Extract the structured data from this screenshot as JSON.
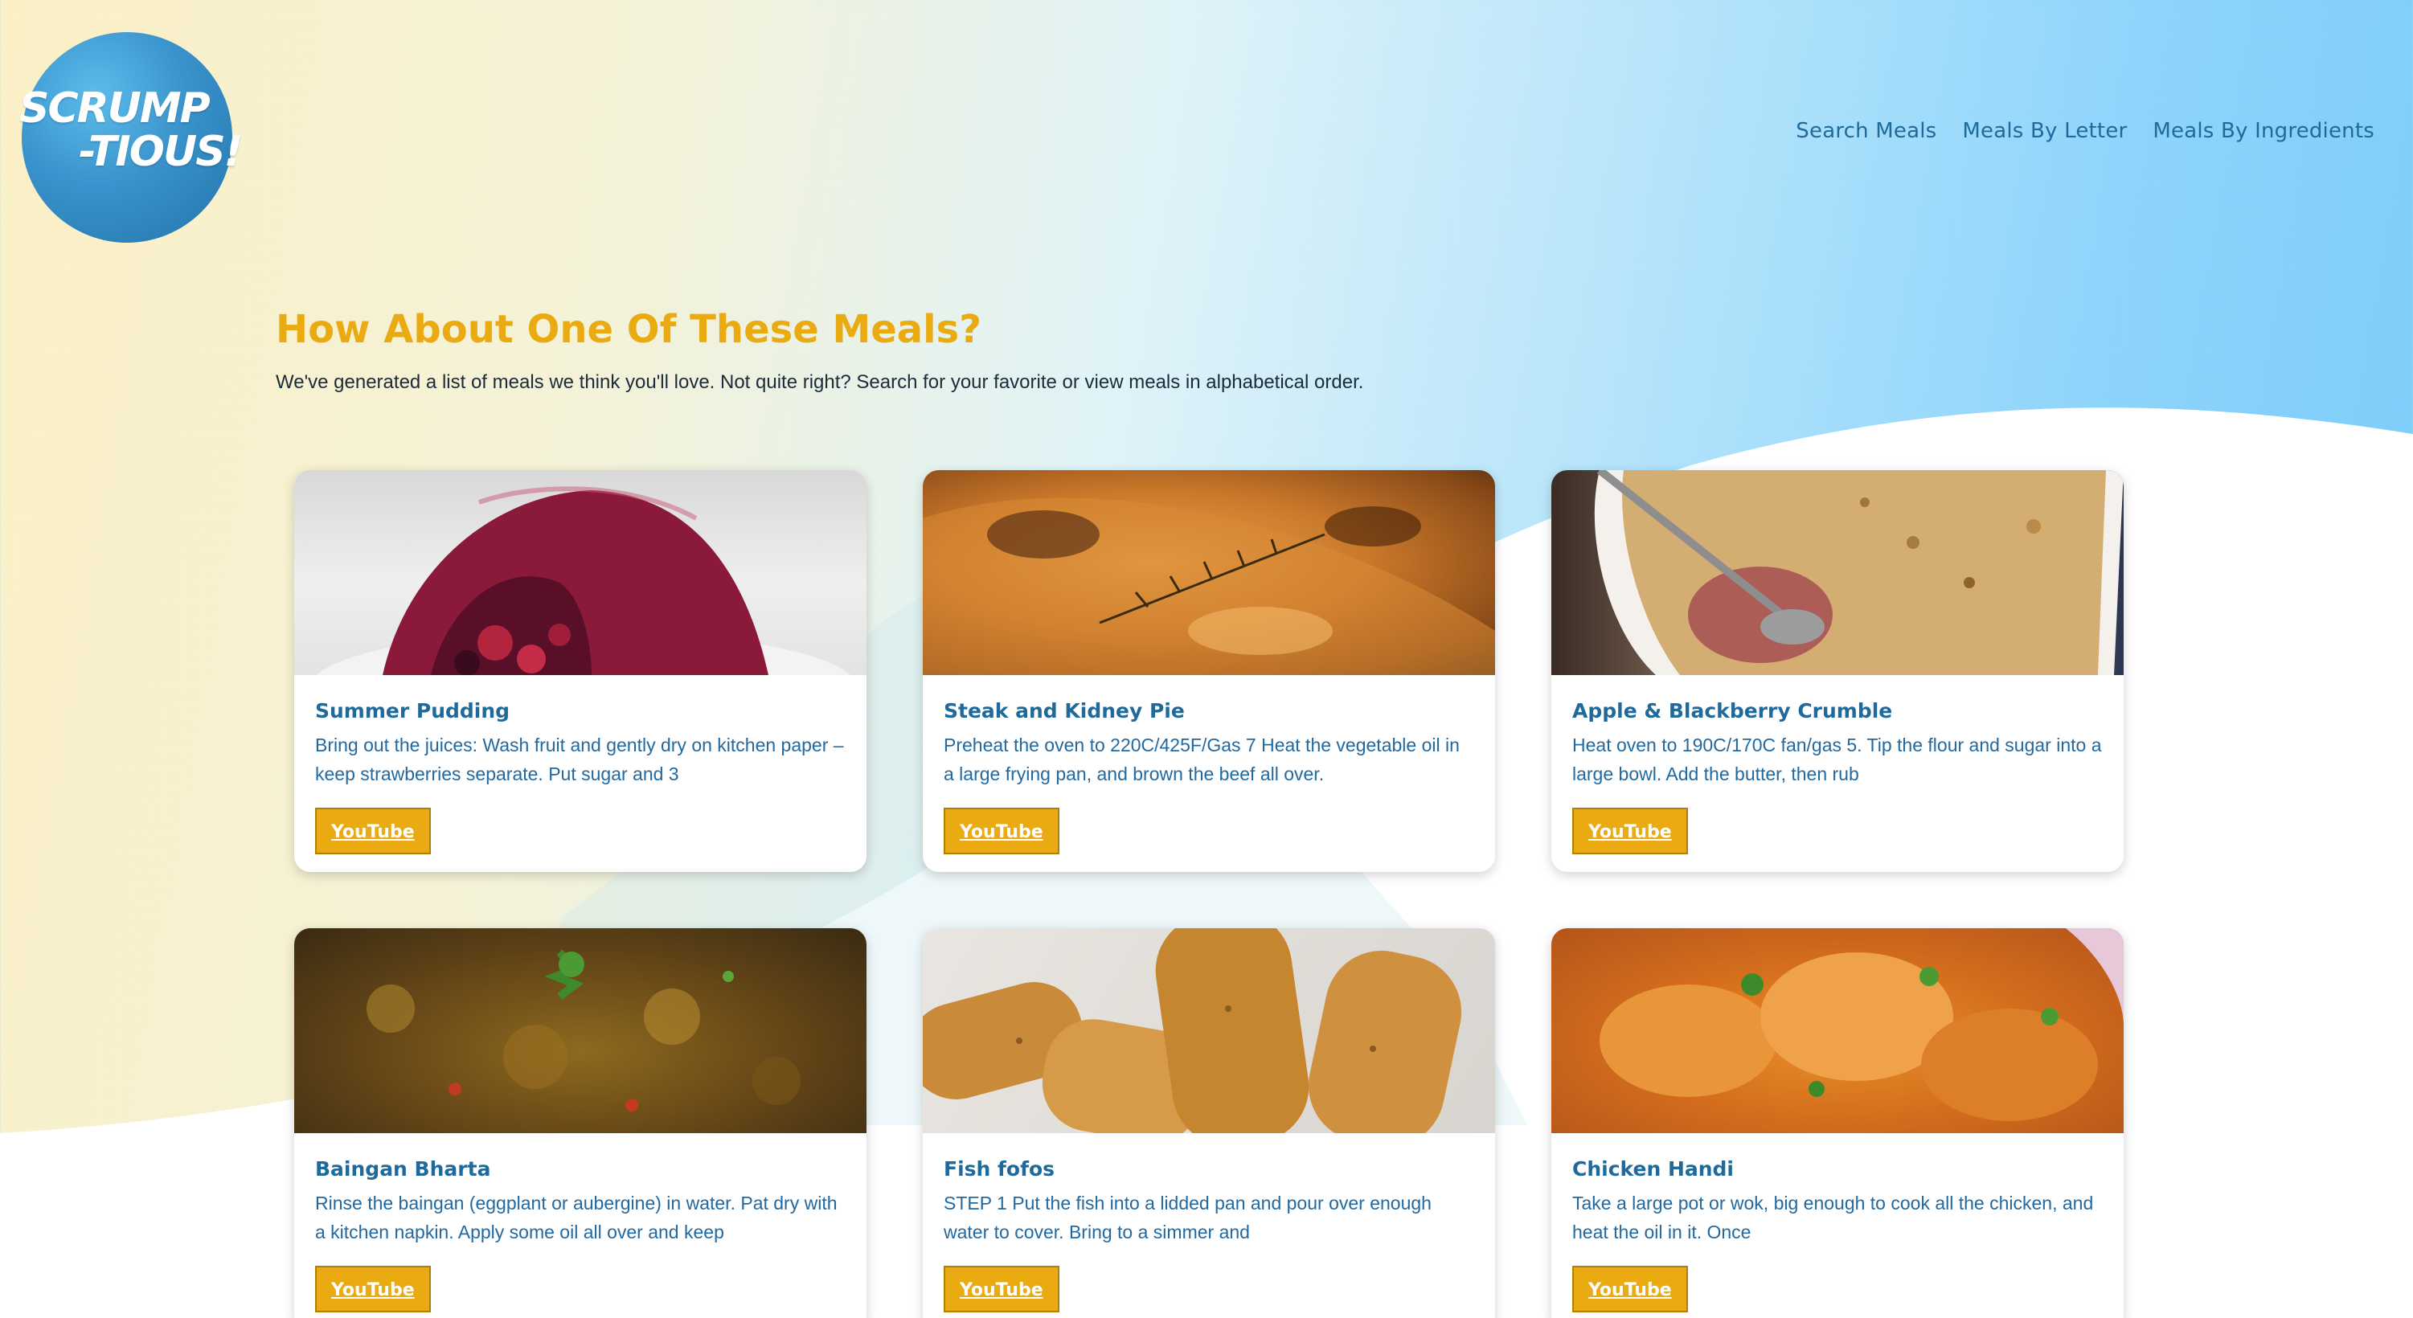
{
  "logo": {
    "line1": "SCRUMP",
    "line2": "-TIOUS!"
  },
  "nav": {
    "items": [
      {
        "label": "Search Meals"
      },
      {
        "label": "Meals By Letter"
      },
      {
        "label": "Meals By Ingredients"
      }
    ]
  },
  "main": {
    "title": "How About One Of These Meals?",
    "subtitle": "We've generated a list of meals we think you'll love. Not quite right? Search for your favorite or view meals in alphabetical order."
  },
  "meals": [
    {
      "name": "Summer Pudding",
      "description": "Bring out the juices: Wash fruit and gently dry on kitchen paper – keep strawberries separate. Put sugar and 3",
      "button": "YouTube",
      "image_icon": "summer-pudding-image"
    },
    {
      "name": "Steak and Kidney Pie",
      "description": "Preheat the oven to 220C/425F/Gas 7 Heat the vegetable oil in a large frying pan, and brown the beef all over.",
      "button": "YouTube",
      "image_icon": "steak-and-kidney-pie-image"
    },
    {
      "name": "Apple & Blackberry Crumble",
      "description": "Heat oven to 190C/170C fan/gas 5. Tip the flour and sugar into a large bowl. Add the butter, then rub",
      "button": "YouTube",
      "image_icon": "apple-blackberry-crumble-image"
    },
    {
      "name": "Baingan Bharta",
      "description": "Rinse the baingan (eggplant or aubergine) in water. Pat dry with a kitchen napkin. Apply some oil all over and keep",
      "button": "YouTube",
      "image_icon": "baingan-bharta-image"
    },
    {
      "name": "Fish fofos",
      "description": "STEP 1 Put the fish into a lidded pan and pour over enough water to cover. Bring to a simmer and",
      "button": "YouTube",
      "image_icon": "fish-fofos-image"
    },
    {
      "name": "Chicken Handi",
      "description": "Take a large pot or wok, big enough to cook all the chicken, and heat the oil in it. Once",
      "button": "YouTube",
      "image_icon": "chicken-handi-image"
    }
  ],
  "colors": {
    "accent": "#eaab12",
    "link": "#1f6a9a",
    "text": "#1c2b3a"
  }
}
